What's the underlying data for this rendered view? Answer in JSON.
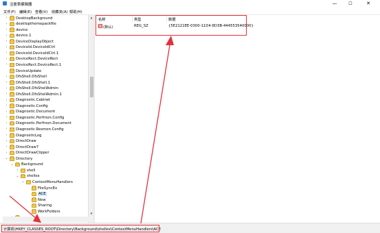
{
  "window": {
    "title": "注册表编辑器",
    "minimize": "—",
    "maximize": "☐",
    "close": "✕"
  },
  "menu": [
    "文件(F)",
    "编辑(E)",
    "查看(V)",
    "收藏夹(A)",
    "帮助(H)"
  ],
  "tree": {
    "items": [
      {
        "label": "DesktopBackground",
        "depth": 2,
        "arrow": "›"
      },
      {
        "label": "desktopthemepackfile",
        "depth": 2,
        "arrow": "›"
      },
      {
        "label": "device",
        "depth": 2,
        "arrow": "›"
      },
      {
        "label": "device.1",
        "depth": 2,
        "arrow": "›"
      },
      {
        "label": "DeviceDisplayObject",
        "depth": 2,
        "arrow": "›"
      },
      {
        "label": "DeviceId.DeviceIdCtrl",
        "depth": 2,
        "arrow": "›"
      },
      {
        "label": "DeviceId.DeviceIdCtrl.1",
        "depth": 2,
        "arrow": "›"
      },
      {
        "label": "DeviceRect.DeviceRect",
        "depth": 2,
        "arrow": "›"
      },
      {
        "label": "DeviceRect.DeviceRect.1",
        "depth": 2,
        "arrow": "›"
      },
      {
        "label": "DeviceUpdate",
        "depth": 2,
        "arrow": ""
      },
      {
        "label": "DfsShell.DfsShell",
        "depth": 2,
        "arrow": "›"
      },
      {
        "label": "DfsShell.DfsShell.1",
        "depth": 2,
        "arrow": "›"
      },
      {
        "label": "DfsShell.DfsShellAdmin",
        "depth": 2,
        "arrow": "›"
      },
      {
        "label": "DfsShell.DfsShellAdmin.1",
        "depth": 2,
        "arrow": "›"
      },
      {
        "label": "Diagnostic.Cabinet",
        "depth": 2,
        "arrow": "›"
      },
      {
        "label": "Diagnostic.Config",
        "depth": 2,
        "arrow": "›"
      },
      {
        "label": "Diagnostic.Document",
        "depth": 2,
        "arrow": "›"
      },
      {
        "label": "Diagnostic.Perfmon.Config",
        "depth": 2,
        "arrow": "›"
      },
      {
        "label": "Diagnostic.Perfmon.Document",
        "depth": 2,
        "arrow": "›"
      },
      {
        "label": "Diagnostic.Resmon.Config",
        "depth": 2,
        "arrow": "›"
      },
      {
        "label": "DiagnosticLog",
        "depth": 2,
        "arrow": "›"
      },
      {
        "label": "DirectDraw",
        "depth": 2,
        "arrow": "›"
      },
      {
        "label": "DirectDraw7",
        "depth": 2,
        "arrow": "›"
      },
      {
        "label": "DirectDrawClipper",
        "depth": 2,
        "arrow": "›"
      },
      {
        "label": "Directory",
        "depth": 2,
        "arrow": "⌄"
      },
      {
        "label": "Background",
        "depth": 3,
        "arrow": "⌄"
      },
      {
        "label": "shell",
        "depth": 4,
        "arrow": "›"
      },
      {
        "label": "shellex",
        "depth": 4,
        "arrow": "⌄"
      },
      {
        "label": "ContextMenuHandlers",
        "depth": 5,
        "arrow": "⌄"
      },
      {
        "label": "FileSyncEx",
        "depth": 6,
        "arrow": ""
      },
      {
        "label": "ACE",
        "depth": 6,
        "arrow": "",
        "selected": true
      },
      {
        "label": "New",
        "depth": 6,
        "arrow": ""
      },
      {
        "label": "Sharing",
        "depth": 6,
        "arrow": ""
      },
      {
        "label": "WorkFolders",
        "depth": 6,
        "arrow": ""
      },
      {
        "label": "",
        "depth": 3,
        "arrow": "›"
      }
    ]
  },
  "values": {
    "headers": {
      "name": "名称",
      "type": "类型",
      "data": "数据"
    },
    "rows": [
      {
        "name": "(默认)",
        "type": "REG_SZ",
        "data": "{5E2121EE-0300-11D4-8D3B-444553540000}",
        "icon": "ab"
      }
    ]
  },
  "status": {
    "path": "计算机\\HKEY_CLASSES_ROOT\\Directory\\Background\\shellex\\ContextMenuHandlers\\ACE"
  },
  "colors": {
    "annotation": "#e3313a",
    "selection": "#cce8ff",
    "folder": "#f0c850"
  }
}
